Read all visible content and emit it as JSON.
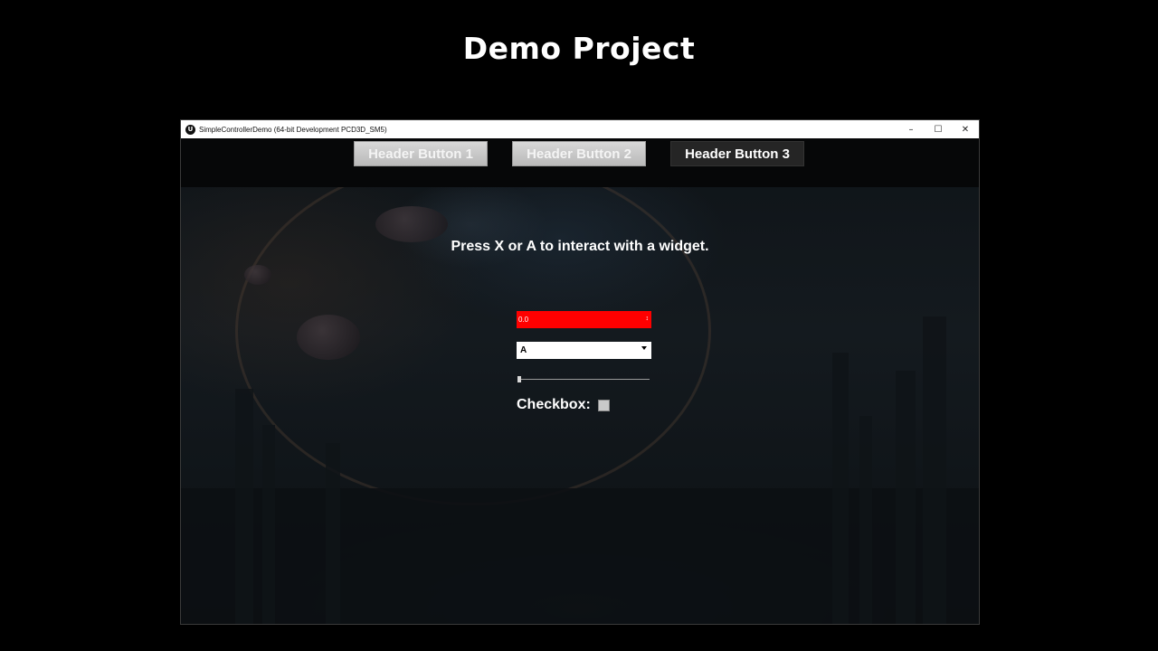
{
  "slide": {
    "title": "Demo Project"
  },
  "window": {
    "title": "SimpleControllerDemo (64-bit Development PCD3D_SM5)",
    "app_icon_letter": "U",
    "controls": {
      "minimize": "–",
      "maximize": "☐",
      "close": "✕"
    }
  },
  "header": {
    "buttons": [
      {
        "label": "Header Button 1"
      },
      {
        "label": "Header Button 2"
      },
      {
        "label": "Header Button 3"
      }
    ]
  },
  "main": {
    "prompt": "Press X or A to interact with a widget.",
    "spinbox": {
      "value": "0.0",
      "color": "#ff0000"
    },
    "combobox": {
      "selected": "A"
    },
    "slider": {
      "value": 0.0
    },
    "checkbox": {
      "label": "Checkbox:",
      "checked": false
    }
  }
}
